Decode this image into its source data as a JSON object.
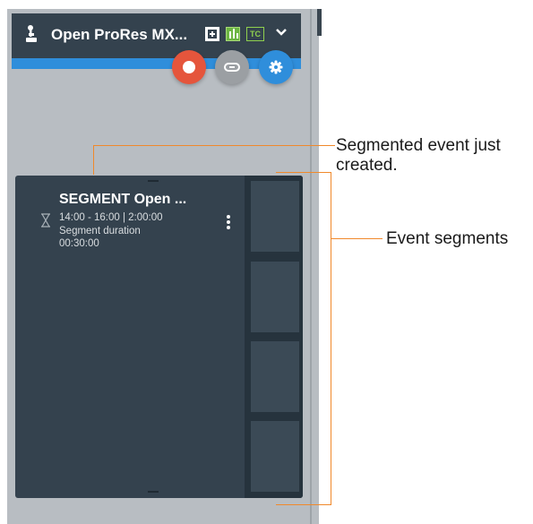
{
  "header": {
    "title": "Open ProRes MX...",
    "badge_tc": "TC",
    "icons": [
      "joystick-icon",
      "plus-box-icon",
      "levels-icon",
      "tc-badge",
      "chevron-down-icon"
    ]
  },
  "actions": [
    {
      "name": "record-button",
      "icon": "record-icon",
      "color": "#e5553c"
    },
    {
      "name": "link-button",
      "icon": "link-icon",
      "color": "#9b9fa3"
    },
    {
      "name": "settings-button",
      "icon": "gear-icon",
      "color": "#2f8edb"
    }
  ],
  "event": {
    "title": "SEGMENT Open ...",
    "time_range": "14:00 - 16:00  |  2:00:00",
    "segment_duration_label": "Segment duration",
    "segment_duration_value": "00:30:00",
    "segments_count": 4
  },
  "annotations": {
    "segmented_event_line1": "Segmented event just",
    "segmented_event_line2": "created.",
    "event_segments": "Event segments"
  },
  "colors": {
    "panel": "#b8bdc2",
    "header": "#34424e",
    "accent_blue": "#2f8edb",
    "record_red": "#e5553c",
    "annotation_orange": "#f0892b"
  }
}
